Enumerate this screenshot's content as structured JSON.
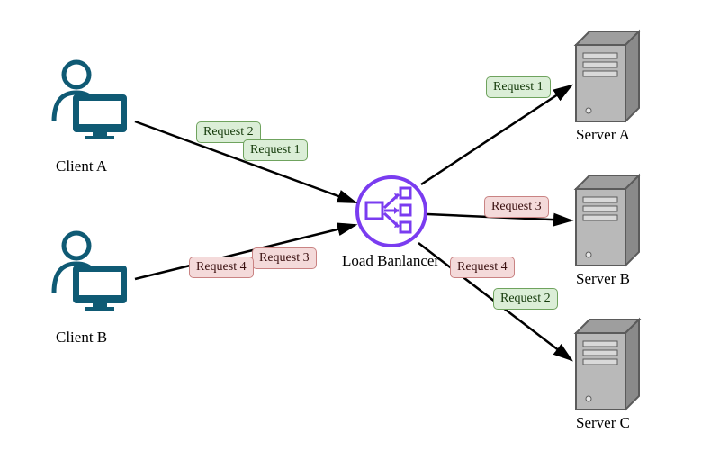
{
  "nodes": {
    "client_a": "Client A",
    "client_b": "Client B",
    "load_balancer": "Load Banlancer",
    "server_a": "Server A",
    "server_b": "Server B",
    "server_c": "Server C"
  },
  "requests": {
    "client_a_r1": "Request 1",
    "client_a_r2": "Request 2",
    "client_b_r3": "Request 3",
    "client_b_r4": "Request 4",
    "to_server_a": "Request 1",
    "to_server_b": "Request 3",
    "to_server_c_top": "Request 4",
    "to_server_c_bottom": "Request 2"
  },
  "semantics": {
    "description": "Network load balancer diagram. Two clients send requests to a load balancer which distributes them to three backend servers.",
    "flows": [
      {
        "from": "Client A",
        "via": "Load Balancer",
        "request": "Request 1",
        "to": "Server A"
      },
      {
        "from": "Client A",
        "via": "Load Balancer",
        "request": "Request 2",
        "to": "Server C"
      },
      {
        "from": "Client B",
        "via": "Load Balancer",
        "request": "Request 3",
        "to": "Server B"
      },
      {
        "from": "Client B",
        "via": "Load Balancer",
        "request": "Request 4",
        "to": "Server C"
      }
    ],
    "tag_colors": {
      "green": "#dbeed7",
      "red": "#f4dada"
    },
    "accent_color": "#7a3cf0"
  }
}
